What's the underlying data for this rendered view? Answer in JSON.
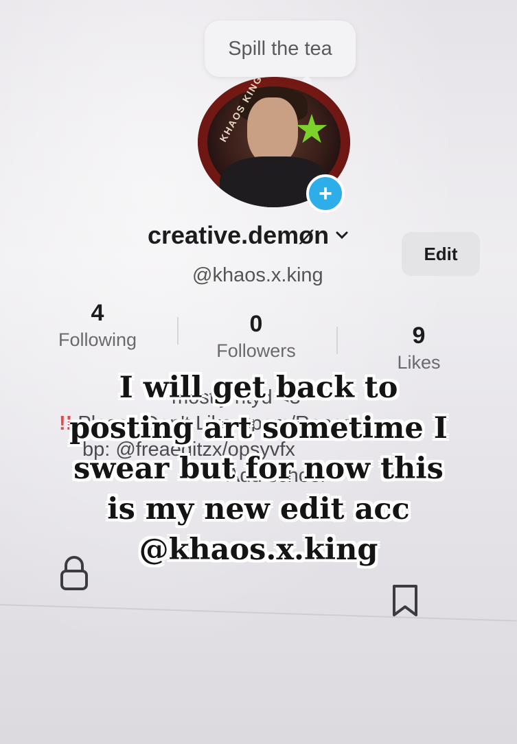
{
  "popup": {
    "bubble_text": "Spill the tea"
  },
  "profile": {
    "display_name": "creative.demøn",
    "handle": "@khaos.x.king",
    "edit_label": "Edit",
    "avatar_ring_text": "KHAOS KING"
  },
  "stats": {
    "following": {
      "count": "4",
      "label": "Following"
    },
    "followers": {
      "count": "0",
      "label": "Followers"
    },
    "likes": {
      "count": "9",
      "label": "Likes"
    }
  },
  "bio": {
    "line1": "mostly ntyd <3",
    "line2_prefix": "!!",
    "line2": "Please Don't Like Spam/Repost",
    "line3": "bp: @freaeditzx/opsyvfx",
    "line4": "Add school"
  },
  "caption": {
    "line1": "I will get back to",
    "line2": "posting art sometime I",
    "line3": "swear but for now this",
    "line4": "is my new edit acc",
    "line5": "@khaos.x.king"
  },
  "colors": {
    "accent": "#2eaee8",
    "text": "#1c1c1c",
    "muted": "#6a6a6e"
  }
}
